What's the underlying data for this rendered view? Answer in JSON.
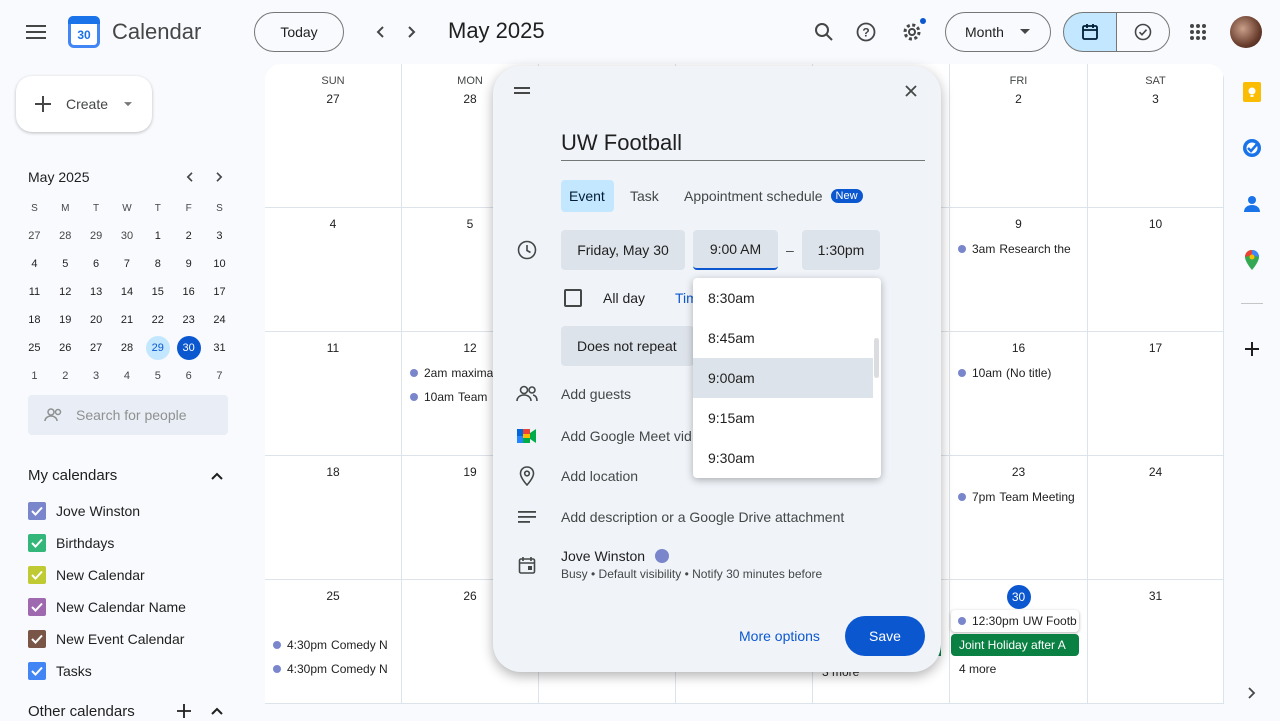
{
  "header": {
    "app_name": "Calendar",
    "logo_day": "30",
    "today_label": "Today",
    "period_title": "May 2025",
    "view_label": "Month"
  },
  "sidebar": {
    "create_label": "Create",
    "mini_title": "May 2025",
    "mini_dow": [
      "S",
      "M",
      "T",
      "W",
      "T",
      "F",
      "S"
    ],
    "mini_days": [
      "27",
      "28",
      "29",
      "30",
      "1",
      "2",
      "3",
      "4",
      "5",
      "6",
      "7",
      "8",
      "9",
      "10",
      "11",
      "12",
      "13",
      "14",
      "15",
      "16",
      "17",
      "18",
      "19",
      "20",
      "21",
      "22",
      "23",
      "24",
      "25",
      "26",
      "27",
      "28",
      "29",
      "30",
      "31",
      "1",
      "2",
      "3",
      "4",
      "5",
      "6",
      "7"
    ],
    "search_people_placeholder": "Search for people",
    "my_calendars_title": "My calendars",
    "calendars": [
      {
        "name": "Jove Winston",
        "color": "#7986cb"
      },
      {
        "name": "Birthdays",
        "color": "#33b679"
      },
      {
        "name": "New Calendar",
        "color": "#c0ca33"
      },
      {
        "name": "New Calendar Name",
        "color": "#9e69af"
      },
      {
        "name": "New Event Calendar",
        "color": "#795548"
      },
      {
        "name": "Tasks",
        "color": "#4285f4"
      }
    ],
    "other_calendars_title": "Other calendars"
  },
  "grid": {
    "dow": [
      "SUN",
      "MON",
      "TUE",
      "WED",
      "THU",
      "FRI",
      "SAT"
    ],
    "days": [
      [
        "27",
        "28",
        "",
        "",
        "",
        "2",
        "3"
      ],
      [
        "4",
        "5",
        "",
        "",
        "",
        "9",
        "10"
      ],
      [
        "11",
        "12",
        "",
        "",
        "",
        "16",
        "17"
      ],
      [
        "18",
        "19",
        "",
        "",
        "",
        "23",
        "24"
      ],
      [
        "25",
        "26",
        "",
        "",
        "",
        "30",
        "31"
      ]
    ],
    "events": {
      "fri9": {
        "time": "3am",
        "title": "Research the"
      },
      "mon12a": {
        "time": "2am",
        "title": "maxima"
      },
      "mon12b": {
        "time": "10am",
        "title": "Team"
      },
      "fri16": {
        "time": "10am",
        "title": "(No title)"
      },
      "fri23": {
        "time": "7pm",
        "title": "Team Meeting"
      },
      "sun25a": {
        "time": "4:30pm",
        "title": "Comedy N"
      },
      "sun25b": {
        "time": "4:30pm",
        "title": "Comedy N"
      },
      "fri30a": {
        "time": "12:30pm",
        "title": "UW Footb"
      },
      "fri30b": {
        "title": "Joint Holiday after A"
      },
      "fri30more": "4 more",
      "thu_more": "3 more"
    }
  },
  "dialog": {
    "title_value": "UW Football",
    "tabs": {
      "event": "Event",
      "task": "Task",
      "appointment": "Appointment schedule",
      "new_badge": "New"
    },
    "date_label": "Friday, May 30",
    "start_time": "9:00 AM",
    "dash": "–",
    "end_time": "1:30pm",
    "all_day_label": "All day",
    "timezone_link": "Tim",
    "repeat_label": "Does not repeat",
    "add_guests": "Add guests",
    "add_meet": "Add Google Meet vid",
    "add_location": "Add location",
    "add_description": "Add description or a Google Drive attachment",
    "owner_name": "Jove Winston",
    "owner_details": "Busy • Default visibility • Notify 30 minutes before",
    "more_options": "More options",
    "save": "Save",
    "time_options": [
      "8:30am",
      "8:45am",
      "9:00am",
      "9:15am",
      "9:30am"
    ],
    "selected_time": "9:00am"
  },
  "colors": {
    "accent": "#0b57d0",
    "event_dot": "#7986cb",
    "holiday": "#0b8043"
  }
}
